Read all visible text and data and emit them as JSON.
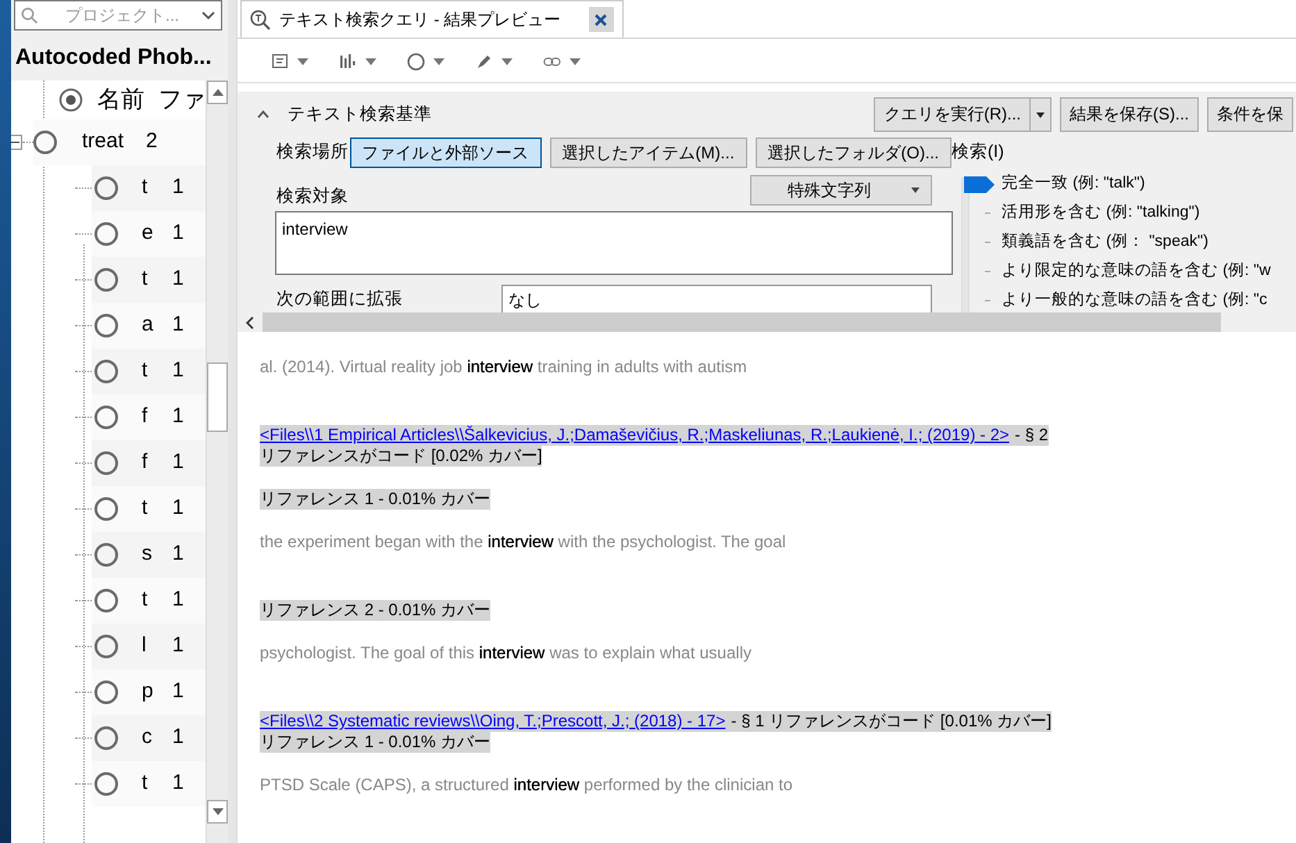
{
  "sidebar": {
    "search": {
      "placeholder": "プロジェクト..."
    },
    "title": "Autocoded Phob...",
    "tree": {
      "columns": [
        "名前",
        "ファ"
      ],
      "items": [
        {
          "name": "treat",
          "count": "2",
          "expanded": true,
          "children": [
            {
              "name": "t",
              "count": "1"
            },
            {
              "name": "e",
              "count": "1"
            },
            {
              "name": "t",
              "count": "1"
            },
            {
              "name": "a",
              "count": "1"
            },
            {
              "name": "t",
              "count": "1"
            },
            {
              "name": "f",
              "count": "1"
            },
            {
              "name": "f",
              "count": "1"
            },
            {
              "name": "t",
              "count": "1"
            },
            {
              "name": "s",
              "count": "1"
            },
            {
              "name": "t",
              "count": "1"
            },
            {
              "name": "l",
              "count": "1"
            },
            {
              "name": "p",
              "count": "1"
            },
            {
              "name": "c",
              "count": "1"
            },
            {
              "name": "t",
              "count": "1"
            }
          ]
        }
      ]
    }
  },
  "tabs": [
    {
      "label": "テキスト検索クエリ - 結果プレビュー",
      "selected": true
    }
  ],
  "criteria": {
    "title": "テキスト検索基準",
    "expanded": true,
    "actions": [
      "クエリを実行(R)...",
      "結果を保存(S)...",
      "条件を保"
    ],
    "search_in": {
      "label": "検索場所",
      "options": [
        {
          "label": "ファイルと外部ソース",
          "selected": true
        },
        {
          "label": "選択したアイテム(M)...",
          "selected": false
        },
        {
          "label": "選択したフォルダ(O)...",
          "selected": false
        }
      ]
    },
    "search_for": {
      "label": "検索対象",
      "special": "特殊文字列",
      "value": "interview"
    },
    "extend": {
      "label": "次の範囲に拡張",
      "value": "なし"
    },
    "match": {
      "label": "検索(I)",
      "options": [
        {
          "label": "完全一致 (例: \"talk\")",
          "selected": true
        },
        {
          "label": "活用形を含む (例: \"talking\")",
          "selected": false
        },
        {
          "label": "類義語を含む (例：  \"speak\")",
          "selected": false
        },
        {
          "label": "より限定的な意味の語を含む (例: \"w",
          "selected": false
        },
        {
          "label": "より一般的な意味の語を含む (例: \"c",
          "selected": false
        }
      ]
    }
  },
  "results": [
    {
      "kind": "excerpt",
      "text": "al. (2014). Virtual reality job **interview** training in adults with autism"
    },
    {
      "kind": "source",
      "link": "<Files\\\\1 Empirical Articles\\\\Šalkevicius, J.;Damaševičius, R.;Maskeliunas, R.;Laukienė, I.; (2019) - 2>",
      "suffix": "- § 2"
    },
    {
      "kind": "heading",
      "text": "リファレンスがコード  [0.02% カバー]"
    },
    {
      "kind": "heading",
      "text": "リファレンス 1 - 0.01% カバー"
    },
    {
      "kind": "excerpt",
      "text": "the experiment began with the **interview** with the psychologist. The goal"
    },
    {
      "kind": "heading",
      "text": "リファレンス 2 - 0.01% カバー"
    },
    {
      "kind": "excerpt",
      "text": "psychologist. The goal of this **interview** was to explain what usually"
    },
    {
      "kind": "source",
      "link": "<Files\\\\2 Systematic reviews\\\\Oing, T.;Prescott, J.; (2018) - 17>",
      "suffix": "- § 1 リファレンスがコード  [0.01% カバー]"
    },
    {
      "kind": "heading",
      "text": "リファレンス 1 - 0.01% カバー"
    },
    {
      "kind": "excerpt",
      "text": "PTSD Scale (CAPS), a structured **interview** performed by the clinician to"
    }
  ]
}
